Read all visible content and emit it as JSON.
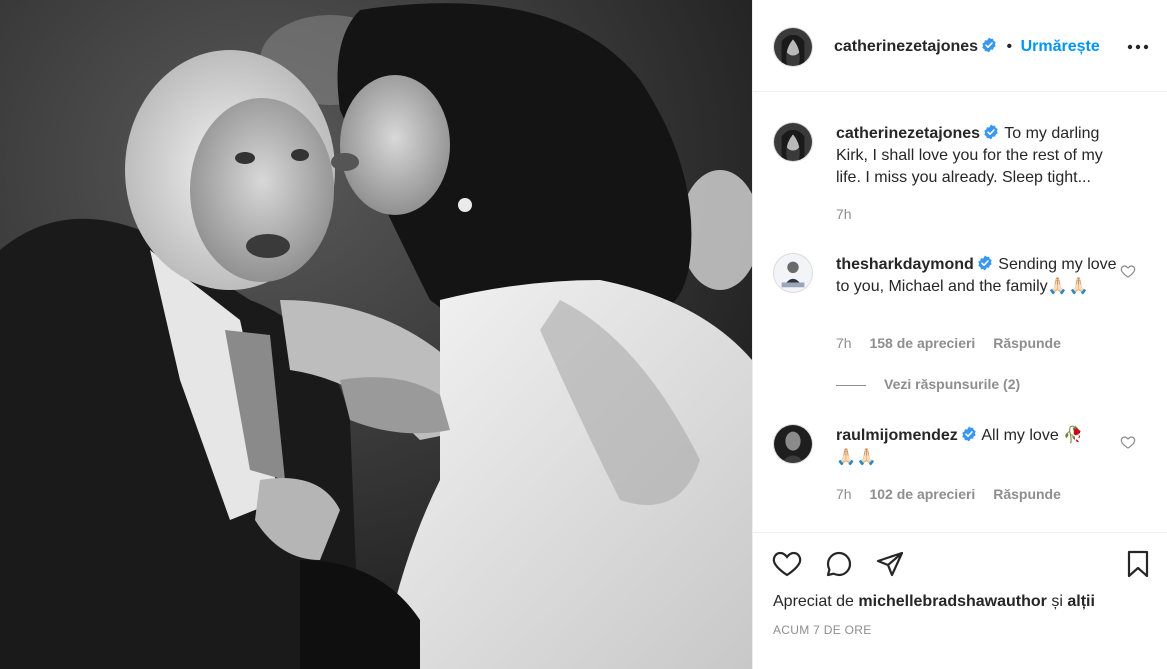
{
  "post": {
    "author": "catherinezetajones",
    "separator": "•",
    "follow_label": "Urmărește",
    "more_icon": "more-options-icon"
  },
  "caption": {
    "username": "catherinezetajones",
    "text": "To my darling Kirk, I shall love you for the rest of my life. I miss you already. Sleep tight...",
    "time": "7h"
  },
  "comments": [
    {
      "username": "thesharkdaymond",
      "text": "Sending my love to you, Michael and the family",
      "emoji": "🙏🏻🙏🏻",
      "time": "7h",
      "likes": "158 de aprecieri",
      "reply_label": "Răspunde"
    },
    {
      "username": "raulmijomendez",
      "text": "All my love 🥀",
      "emoji": "🙏🏻🙏🏻",
      "time": "7h",
      "likes": "102 de aprecieri",
      "reply_label": "Răspunde"
    }
  ],
  "view_replies": "Vezi răspunsurile (2)",
  "footer": {
    "liked_prefix": "Apreciat de",
    "liked_user": "michellebradshawauthor",
    "liked_suffix": "și",
    "liked_others": "alții",
    "timestamp": "ACUM 7 DE ORE"
  },
  "colors": {
    "accent": "#0095f6",
    "verified": "#3897f0",
    "muted": "#8e8e8e",
    "text": "#262626"
  }
}
